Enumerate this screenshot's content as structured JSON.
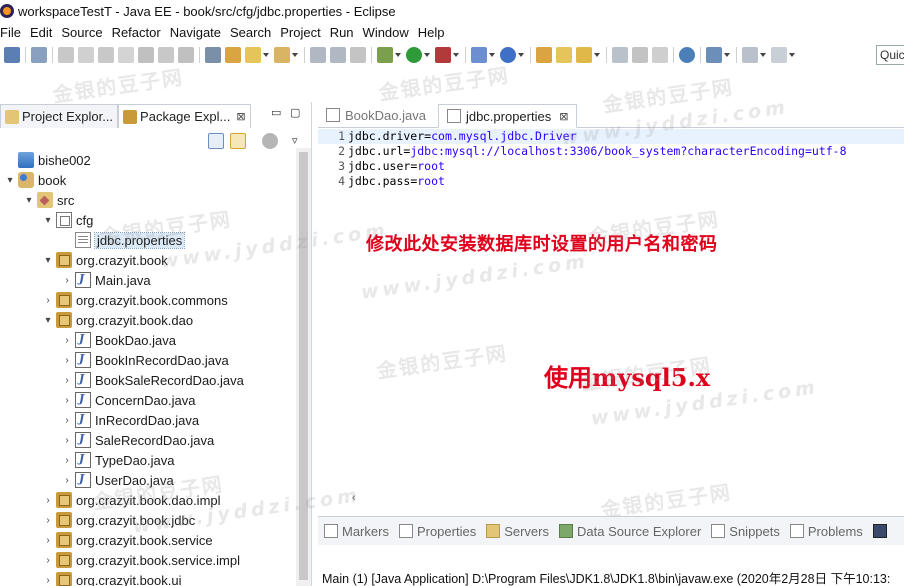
{
  "window": {
    "title": "workspaceTestT - Java EE - book/src/cfg/jdbc.properties - Eclipse"
  },
  "menubar": [
    "File",
    "Edit",
    "Source",
    "Refactor",
    "Navigate",
    "Search",
    "Project",
    "Run",
    "Window",
    "Help"
  ],
  "toolbar": {
    "quick_access": "Quic"
  },
  "left_panel": {
    "tabs": [
      {
        "label": "Project Explor...",
        "close": ""
      },
      {
        "label": "Package Expl...",
        "close": "⊠"
      }
    ],
    "tree": [
      {
        "label": "bishe002",
        "icon": "project-icon",
        "arrow": "",
        "depth": 0
      },
      {
        "label": "book",
        "icon": "java-project-icon",
        "arrow": "▾",
        "depth": 0
      },
      {
        "label": "src",
        "icon": "source-folder-icon",
        "arrow": "▾",
        "depth": 1
      },
      {
        "label": "cfg",
        "icon": "package-folder-icon",
        "arrow": "▾",
        "depth": 2
      },
      {
        "label": "jdbc.properties",
        "icon": "properties-file-icon",
        "arrow": "",
        "depth": 3,
        "selected": true
      },
      {
        "label": "org.crazyit.book",
        "icon": "package-icon",
        "arrow": "▾",
        "depth": 2
      },
      {
        "label": "Main.java",
        "icon": "java-file-icon",
        "arrow": "›",
        "depth": 3
      },
      {
        "label": "org.crazyit.book.commons",
        "icon": "package-icon",
        "arrow": "›",
        "depth": 2
      },
      {
        "label": "org.crazyit.book.dao",
        "icon": "package-icon",
        "arrow": "▾",
        "depth": 2
      },
      {
        "label": "BookDao.java",
        "icon": "java-file-icon",
        "arrow": "›",
        "depth": 3
      },
      {
        "label": "BookInRecordDao.java",
        "icon": "java-file-icon",
        "arrow": "›",
        "depth": 3
      },
      {
        "label": "BookSaleRecordDao.java",
        "icon": "java-file-icon",
        "arrow": "›",
        "depth": 3
      },
      {
        "label": "ConcernDao.java",
        "icon": "java-file-icon",
        "arrow": "›",
        "depth": 3
      },
      {
        "label": "InRecordDao.java",
        "icon": "java-file-icon",
        "arrow": "›",
        "depth": 3
      },
      {
        "label": "SaleRecordDao.java",
        "icon": "java-file-icon",
        "arrow": "›",
        "depth": 3
      },
      {
        "label": "TypeDao.java",
        "icon": "java-file-icon",
        "arrow": "›",
        "depth": 3
      },
      {
        "label": "UserDao.java",
        "icon": "java-file-icon",
        "arrow": "›",
        "depth": 3
      },
      {
        "label": "org.crazyit.book.dao.impl",
        "icon": "package-icon",
        "arrow": "›",
        "depth": 2
      },
      {
        "label": "org.crazyit.book.jdbc",
        "icon": "package-icon",
        "arrow": "›",
        "depth": 2
      },
      {
        "label": "org.crazyit.book.service",
        "icon": "package-icon",
        "arrow": "›",
        "depth": 2
      },
      {
        "label": "org.crazyit.book.service.impl",
        "icon": "package-icon",
        "arrow": "›",
        "depth": 2
      },
      {
        "label": "org.crazyit.book.ui",
        "icon": "package-icon",
        "arrow": "›",
        "depth": 2
      }
    ]
  },
  "editor": {
    "tabs": [
      {
        "label": "BookDao.java",
        "active": false,
        "close": ""
      },
      {
        "label": "jdbc.properties",
        "active": true,
        "close": "⊠"
      }
    ],
    "lines": [
      {
        "num": "1",
        "key": "jdbc.driver",
        "eq": "=",
        "val": "com.mysql.jdbc.Driver"
      },
      {
        "num": "2",
        "key": "jdbc.url",
        "eq": "=",
        "val": "jdbc:mysql://localhost:3306/book_system?characterEncoding=utf-8"
      },
      {
        "num": "3",
        "key": "jdbc.user",
        "eq": "=",
        "val": "root"
      },
      {
        "num": "4",
        "key": "jdbc.pass",
        "eq": "=",
        "val": "root"
      }
    ],
    "annotation_1": "修改此处安装数据库时设置的用户名和密码",
    "annotation_2": "使用mysql5.x"
  },
  "bottom_panel": {
    "tabs": [
      "Markers",
      "Properties",
      "Servers",
      "Data Source Explorer",
      "Snippets",
      "Problems"
    ],
    "console": "Main (1) [Java Application] D:\\Program Files\\JDK1.8\\JDK1.8\\bin\\javaw.exe (2020年2月28日 下午10:13:"
  },
  "watermark": {
    "text": "金银的豆子网",
    "url": "www.jyddzi.com"
  },
  "colors": {
    "accent_red": "#e0001c",
    "selection": "#dbe8f5",
    "string_blue": "#2a00ff"
  }
}
